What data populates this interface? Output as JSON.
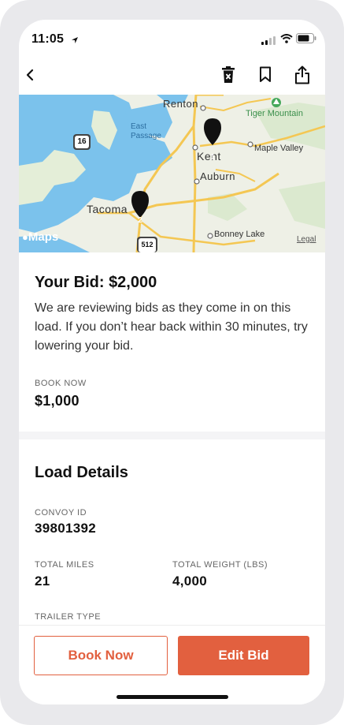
{
  "status_bar": {
    "time": "11:05"
  },
  "header": {
    "icons": [
      "back-chevron-icon",
      "delete-icon",
      "bookmark-icon",
      "share-icon"
    ]
  },
  "map": {
    "labels": {
      "renton": "Renton",
      "tiger_mountain": "Tiger Mountain",
      "east_passage": "East\nPassage",
      "kent": "Kent",
      "maple_valley": "Maple Valley",
      "auburn": "Auburn",
      "tacoma": "Tacoma",
      "bonney_lake": "Bonney Lake",
      "legal": "Legal",
      "maps_brand": "Maps"
    },
    "markers": [
      "1",
      "2"
    ],
    "shields": [
      "16",
      "512"
    ]
  },
  "bid": {
    "title": "Your Bid: $2,000",
    "message": "We are reviewing bids as they come in on this load. If you don’t hear back within 30 minutes, try lowering your bid.",
    "book_now_label": "BOOK NOW",
    "book_now_value": "$1,000"
  },
  "load_details": {
    "title": "Load Details",
    "convoy_id_label": "CONVOY ID",
    "convoy_id": "39801392",
    "total_miles_label": "TOTAL MILES",
    "total_miles": "21",
    "total_weight_label": "TOTAL WEIGHT (LBS)",
    "total_weight": "4,000",
    "trailer_type_label": "TRAILER TYPE"
  },
  "actions": {
    "book_now": "Book Now",
    "edit_bid": "Edit Bid"
  },
  "colors": {
    "accent": "#e2603f",
    "water": "#79c1ee",
    "land": "#efeee6",
    "road": "#f5c84c"
  }
}
